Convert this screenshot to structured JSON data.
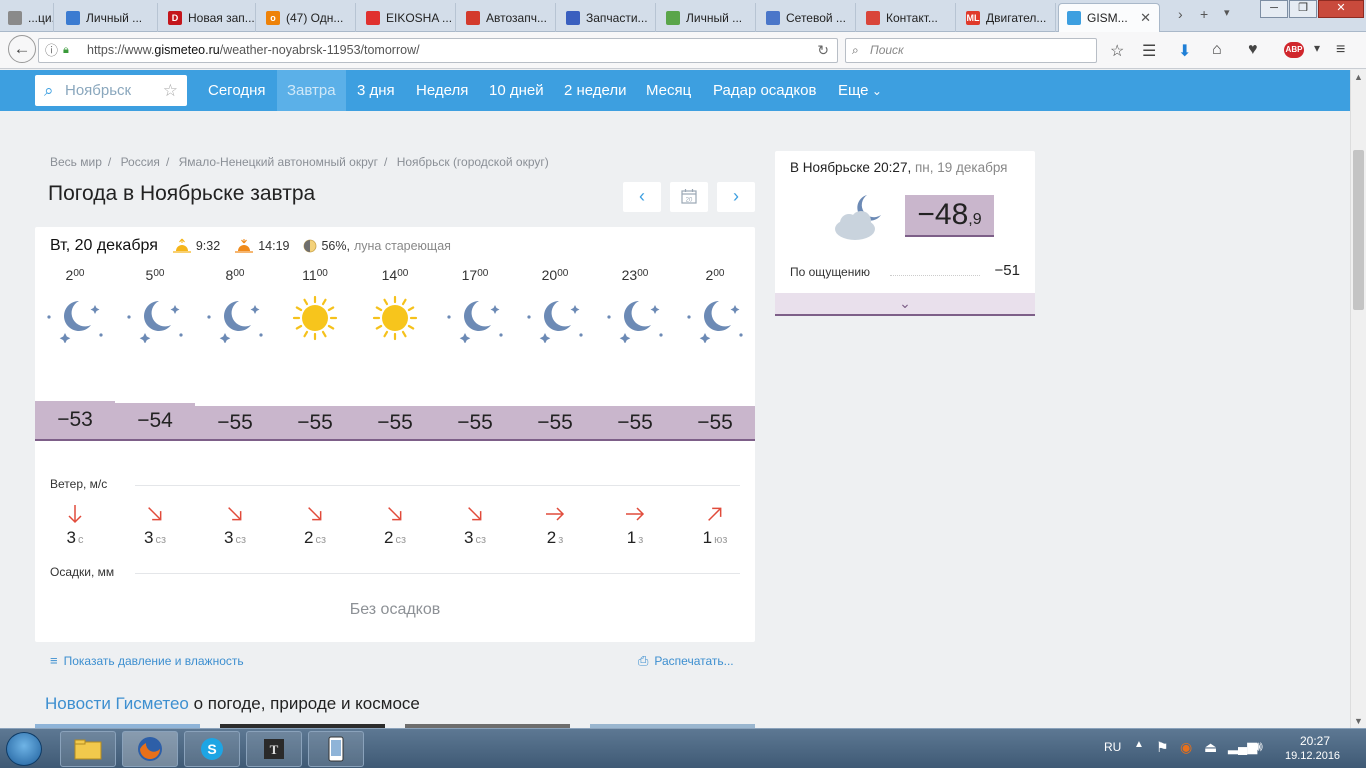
{
  "browser": {
    "tabs": [
      {
        "label": "...ци...",
        "fav": "",
        "fav_color": "#8a8a8a"
      },
      {
        "label": "Личный ...",
        "fav": "",
        "fav_color": "#3b7bd1"
      },
      {
        "label": "Новая зап...",
        "fav": "D",
        "fav_color": "#c4161c"
      },
      {
        "label": "(47) Одн...",
        "fav": "о",
        "fav_color": "#ee8208"
      },
      {
        "label": "EIKOSHA ...",
        "fav": "",
        "fav_color": "#e0312f"
      },
      {
        "label": "Автозапч...",
        "fav": "",
        "fav_color": "#d33a2c"
      },
      {
        "label": "Запчасти...",
        "fav": "",
        "fav_color": "#3a5fbf"
      },
      {
        "label": "Личный ...",
        "fav": "",
        "fav_color": "#5aa54a"
      },
      {
        "label": "Сетевой ...",
        "fav": "",
        "fav_color": "#4a76c9"
      },
      {
        "label": "Контакт...",
        "fav": "",
        "fav_color": "#d9453a"
      },
      {
        "label": "Двигател...",
        "fav": "ML",
        "fav_color": "#e03a2b"
      },
      {
        "label": "GISM...",
        "fav": "",
        "fav_color": "#3d9fe0"
      }
    ],
    "url_prefix": "https://www.",
    "url_host": "gismeteo.ru",
    "url_path": "/weather-noyabrsk-11953/tomorrow/",
    "search_placeholder": "Поиск",
    "abp_badge": "ABP"
  },
  "site": {
    "city_placeholder": "Ноябрьск",
    "menu": [
      "Сегодня",
      "Завтра",
      "3 дня",
      "Неделя",
      "10 дней",
      "2 недели",
      "Месяц",
      "Радар осадков",
      "Еще"
    ],
    "active_menu_index": 1
  },
  "breadcrumb": [
    "Весь мир",
    "Россия",
    "Ямало-Ненецкий автономный округ",
    "Ноябрьск (городской округ)"
  ],
  "page_title": "Погода в Ноябрьске завтра",
  "calendar_day": "20",
  "forecast": {
    "day_label": "Вт, 20 декабря",
    "sunrise": "9:32",
    "sunset": "14:19",
    "moon_phase": "56%,",
    "moon_desc": "луна стареющая",
    "hours": [
      {
        "h": "2",
        "m": "00",
        "icon": "moon-stars",
        "temp": "−53",
        "wind_speed": "3",
        "wind_dir": "с",
        "wind_arrow": "down"
      },
      {
        "h": "5",
        "m": "00",
        "icon": "moon-stars",
        "temp": "−54",
        "wind_speed": "3",
        "wind_dir": "сз",
        "wind_arrow": "down-right"
      },
      {
        "h": "8",
        "m": "00",
        "icon": "moon-stars",
        "temp": "−55",
        "wind_speed": "3",
        "wind_dir": "сз",
        "wind_arrow": "down-right"
      },
      {
        "h": "11",
        "m": "00",
        "icon": "sun",
        "temp": "−55",
        "wind_speed": "2",
        "wind_dir": "сз",
        "wind_arrow": "down-right"
      },
      {
        "h": "14",
        "m": "00",
        "icon": "sun",
        "temp": "−55",
        "wind_speed": "2",
        "wind_dir": "сз",
        "wind_arrow": "down-right"
      },
      {
        "h": "17",
        "m": "00",
        "icon": "moon-stars",
        "temp": "−55",
        "wind_speed": "3",
        "wind_dir": "сз",
        "wind_arrow": "down-right"
      },
      {
        "h": "20",
        "m": "00",
        "icon": "moon-stars",
        "temp": "−55",
        "wind_speed": "2",
        "wind_dir": "з",
        "wind_arrow": "right"
      },
      {
        "h": "23",
        "m": "00",
        "icon": "moon-stars",
        "temp": "−55",
        "wind_speed": "1",
        "wind_dir": "з",
        "wind_arrow": "right"
      },
      {
        "h": "2",
        "m": "00",
        "icon": "moon-stars",
        "temp": "−55",
        "wind_speed": "1",
        "wind_dir": "юз",
        "wind_arrow": "up-right"
      }
    ],
    "wind_label": "Ветер, м/с",
    "precip_label": "Осадки, мм",
    "no_precip": "Без осадков"
  },
  "links": {
    "pressure": "Показать давление и влажность",
    "print": "Распечатать..."
  },
  "news": {
    "title_blue": "Новости Гисметео",
    "title_rest": " о погоде, природе и космосе"
  },
  "now": {
    "title": "В Ноябрьске 20:27,",
    "date": " пн, 19 декабря",
    "temp": "−48",
    "temp_frac": ",9",
    "feels_label": "По ощущению",
    "feels_value": "−51",
    "icon": "cloud-moon"
  },
  "taskbar": {
    "lang": "RU",
    "time": "20:27",
    "date": "19.12.2016"
  },
  "colors": {
    "accent": "#3d9fe0",
    "temp_bg": "#c9b6cc",
    "temp_border": "#7d5f88",
    "wind_arrow": "#e14b3b"
  }
}
